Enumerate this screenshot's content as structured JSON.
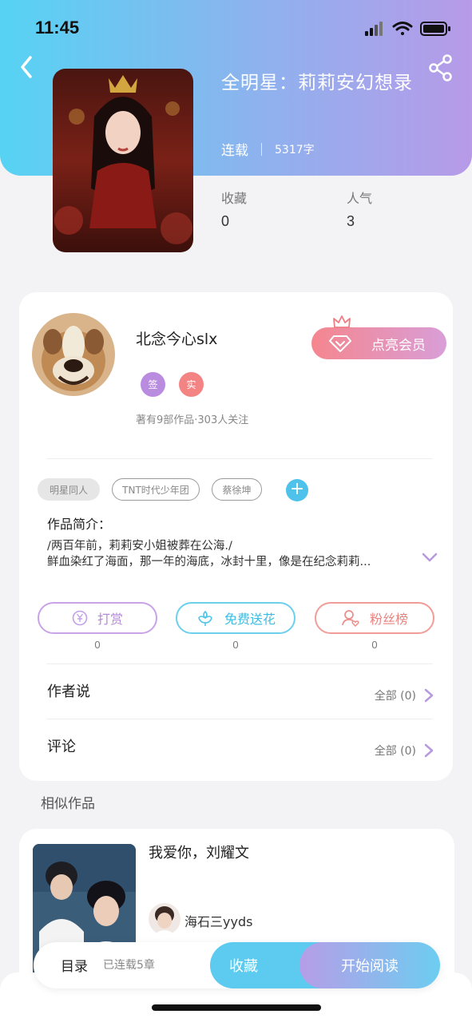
{
  "status_bar": {
    "time": "11:45"
  },
  "book": {
    "title": "全明星：莉莉安幻想录",
    "status": "连载",
    "word_count": "5317字",
    "stats": [
      {
        "label": "收藏",
        "value": "0"
      },
      {
        "label": "人气",
        "value": "3"
      }
    ]
  },
  "author": {
    "name": "北念今心slx",
    "badges": [
      "签",
      "实"
    ],
    "summary": "著有9部作品·303人关注",
    "vip_button": "点亮会员"
  },
  "tags": [
    "明星同人",
    "TNT时代少年团",
    "蔡徐坤"
  ],
  "intro": {
    "title": "作品简介：",
    "line1": "/两百年前，莉莉安小姐被葬在公海./",
    "line2": "鲜血染红了海面，那一年的海底，冰封十里，像是在纪念莉莉..."
  },
  "actions": [
    {
      "label": "打赏",
      "count": "0",
      "icon": "yen-coin-icon"
    },
    {
      "label": "免费送花",
      "count": "0",
      "icon": "flower-icon"
    },
    {
      "label": "粉丝榜",
      "count": "0",
      "icon": "fan-user-icon"
    }
  ],
  "rows": [
    {
      "label": "作者说",
      "right": "全部 (0)"
    },
    {
      "label": "评论",
      "right": "全部 (0)"
    }
  ],
  "similar": {
    "section_title": "相似作品",
    "items": [
      {
        "title": "我爱你，刘耀文",
        "author": "海石三yyds"
      }
    ]
  },
  "bottom_bar": {
    "toc": "目录",
    "toc_status": "已连载5章",
    "collect": "收藏",
    "read": "开始阅读"
  },
  "colors": {
    "header_gradient_start": "#56d3f3",
    "header_gradient_end": "#b79ae8",
    "accent_blue": "#4ec2ea",
    "accent_purple": "#b68ad9",
    "accent_red": "#e98380"
  }
}
